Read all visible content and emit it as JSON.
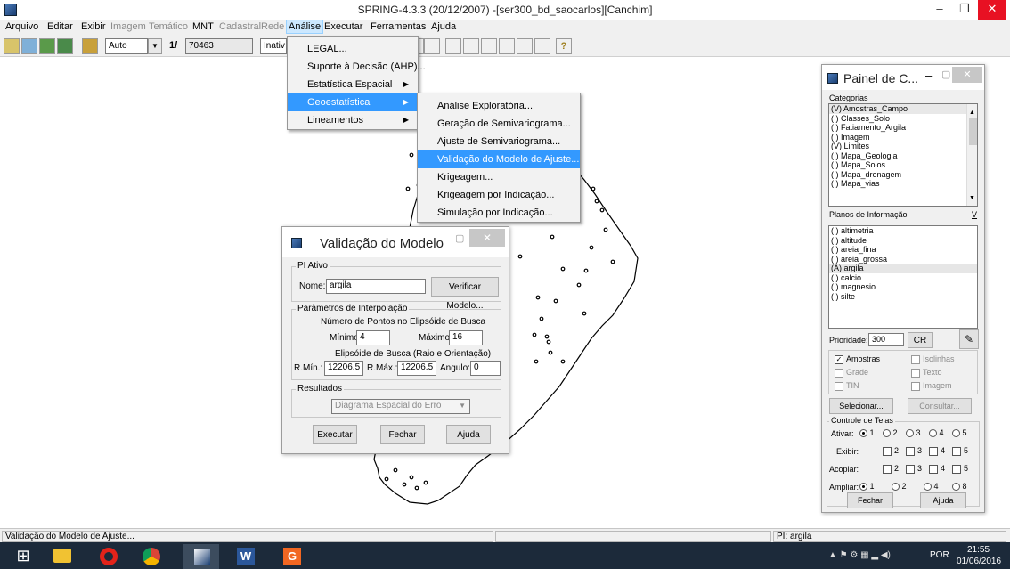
{
  "window": {
    "title": "SPRING-4.3.3 (20/12/2007) -[ser300_bd_saocarlos][Canchim]",
    "min": "–",
    "max": "❐",
    "close": "✕"
  },
  "menubar": [
    "Arquivo",
    "Editar",
    "Exibir",
    "Imagem",
    "Temático",
    "MNT",
    "Cadastral",
    "Rede",
    "Análise",
    "Executar",
    "Ferramentas",
    "Ajuda"
  ],
  "toolbar": {
    "mode_combo": "Auto",
    "scale_prefix": "1/",
    "scale_value": "70463",
    "status_field": "Inativ"
  },
  "analise_menu": [
    "LEGAL...",
    "Suporte à Decisão (AHP)...",
    "Estatística Espacial",
    "Geoestatística",
    "Lineamentos"
  ],
  "geo_submenu": [
    "Análise Exploratória...",
    "Geração de Semivariograma...",
    "Ajuste de Semivariograma...",
    "Validação do Modelo de Ajuste...",
    "Krigeagem...",
    "Krigeagem por Indicação...",
    "Simulação por Indicação..."
  ],
  "dialog": {
    "title": "Validação do Modelo",
    "pi_group": "PI Ativo",
    "name_label": "Nome:",
    "name_value": "argila",
    "verify_btn": "Verificar Modelo...",
    "interp_group": "Parâmetros de Interpolação",
    "points_title": "Número de Pontos no Elipsóide de Busca",
    "min_label": "Mínimo:",
    "min_value": "4",
    "max_label": "Máximo:",
    "max_value": "16",
    "ellipse_title": "Elipsóide de Busca (Raio e Orientação)",
    "rmin_label": "R.Mín.:",
    "rmin_value": "12206.5",
    "rmax_label": "R.Máx.:",
    "rmax_value": "12206.5",
    "angle_label": "Angulo:",
    "angle_value": "0",
    "results_group": "Resultados",
    "results_combo": "Diagrama Espacial do Erro",
    "execute_btn": "Executar",
    "close_btn": "Fechar",
    "help_btn": "Ajuda"
  },
  "panel": {
    "title": "Painel de C...",
    "categories_label": "Categorias",
    "categories": [
      "(V) Amostras_Campo",
      "( ) Classes_Solo",
      "( ) Fatiamento_Argila",
      "( ) Imagem",
      "(V) Limites",
      "( ) Mapa_Geologia",
      "( ) Mapa_Solos",
      "( ) Mapa_drenagem",
      "( ) Mapa_vias"
    ],
    "planes_label": "Planos de Informação",
    "planes_v": "V",
    "planes": [
      "( ) altimetria",
      "( ) altitude",
      "( ) areia_fina",
      "( ) areia_grossa",
      "(A) argila",
      "( ) calcio",
      "( ) magnesio",
      "( ) silte"
    ],
    "priority_label": "Prioridade:",
    "priority_value": "300",
    "cr_btn": "CR",
    "chk_amostras": "Amostras",
    "chk_isolinhas": "Isolinhas",
    "chk_grade": "Grade",
    "chk_texto": "Texto",
    "chk_tin": "TIN",
    "chk_imagem": "Imagem",
    "select_btn": "Selecionar...",
    "consult_btn": "Consultar...",
    "screens_group": "Controle de Telas",
    "ativar": "Ativar:",
    "exibir": "Exibir:",
    "acoplar": "Acoplar:",
    "ampliar": "Ampliar:",
    "n1": "1",
    "n2": "2",
    "n3": "3",
    "n4": "4",
    "n5": "5",
    "n8": "8",
    "fechar_btn": "Fechar",
    "ajuda_btn": "Ajuda"
  },
  "statusbar": {
    "left": "Validação do Modelo de Ajuste...",
    "right": "PI: argila"
  },
  "taskbar": {
    "time": "21:55",
    "date": "01/06/2016",
    "lang": "POR"
  },
  "colors": {
    "highlight": "#3399ff",
    "close": "#e81123",
    "taskbar": "#1c2a3a"
  }
}
